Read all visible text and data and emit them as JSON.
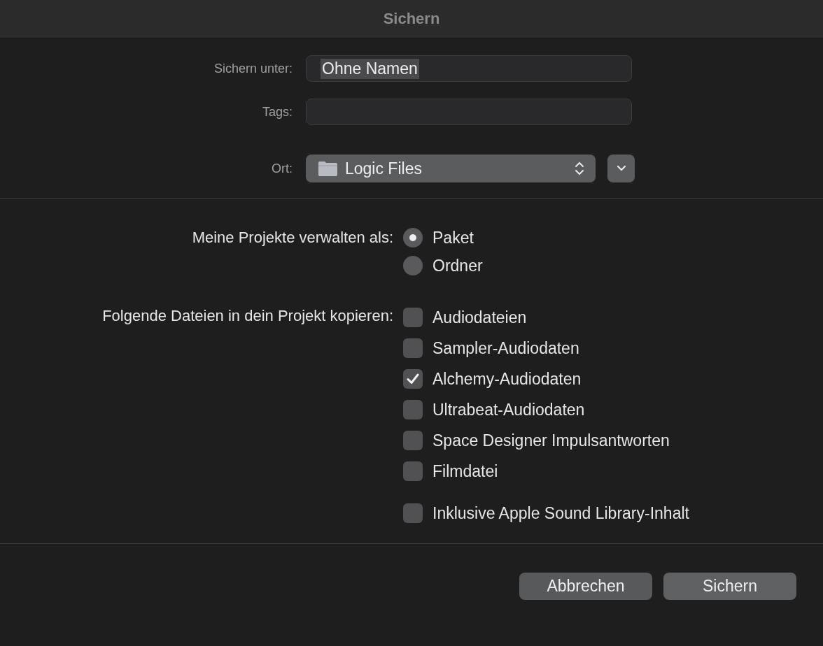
{
  "window": {
    "title": "Sichern"
  },
  "save_as": {
    "label": "Sichern unter:",
    "value": "Ohne Namen",
    "value_selected": true
  },
  "tags": {
    "label": "Tags:"
  },
  "location": {
    "label": "Ort:",
    "value": "Logic Files",
    "expanded": false
  },
  "manage": {
    "label": "Meine Projekte verwalten als:",
    "options": [
      {
        "label": "Paket",
        "selected": true
      },
      {
        "label": "Ordner",
        "selected": false
      }
    ]
  },
  "copy": {
    "label": "Folgende Dateien in dein Projekt kopieren:",
    "options": [
      {
        "label": "Audiodateien",
        "checked": false
      },
      {
        "label": "Sampler-Audiodaten",
        "checked": false
      },
      {
        "label": "Alchemy-Audiodaten",
        "checked": true
      },
      {
        "label": "Ultrabeat-Audiodaten",
        "checked": false
      },
      {
        "label": "Space Designer Impulsantworten",
        "checked": false
      },
      {
        "label": "Filmdatei",
        "checked": false
      }
    ]
  },
  "extra": {
    "label": "Inklusive Apple Sound Library-Inhalt",
    "checked": false
  },
  "buttons": [
    {
      "label": "Abbrechen",
      "kind": "cancel"
    },
    {
      "label": "Sichern",
      "kind": "default"
    }
  ]
}
